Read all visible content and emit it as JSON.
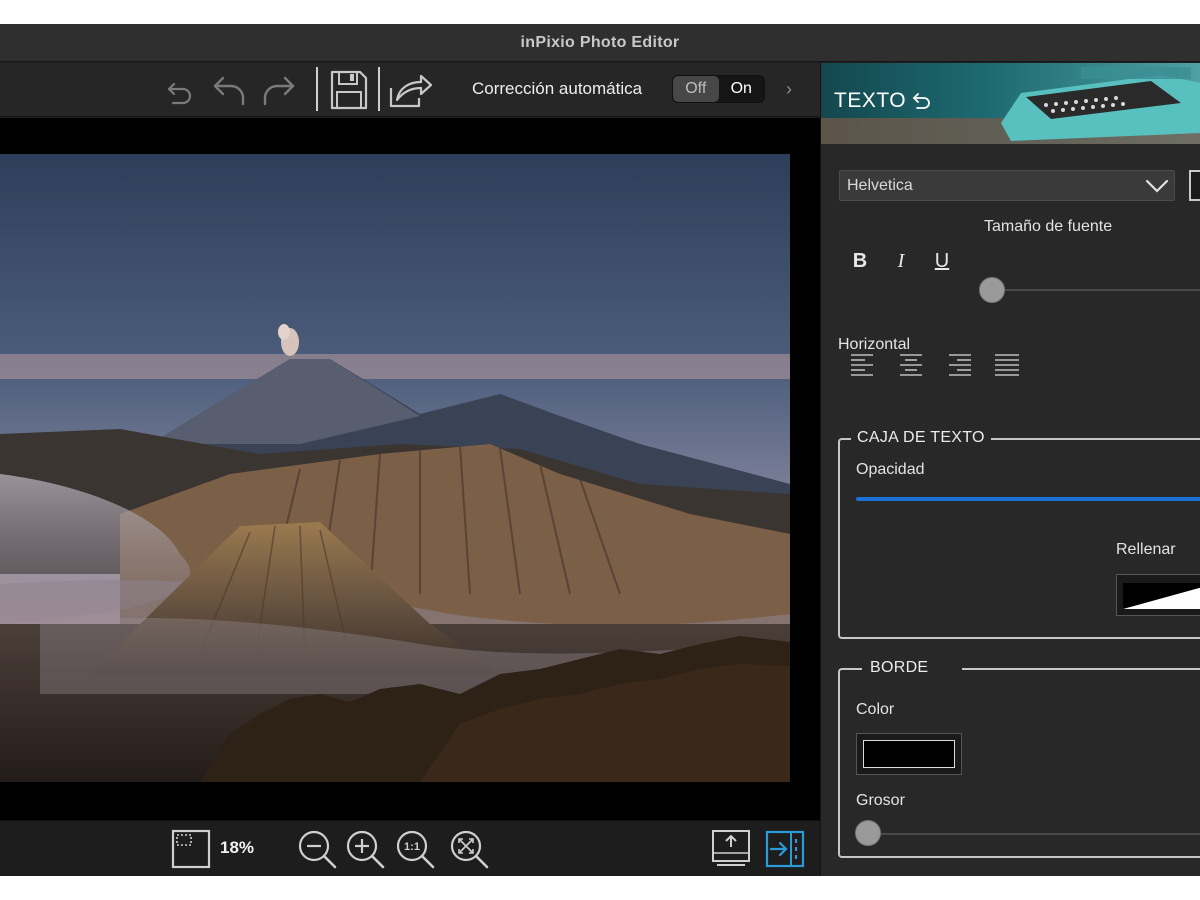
{
  "window": {
    "title": "inPixio Photo Editor"
  },
  "toolbar": {
    "auto_correct_label": "Corrección automática",
    "toggle_off": "Off",
    "toggle_on": "On",
    "toggle_state": "off",
    "more_chevron": "›"
  },
  "canvas": {
    "photo_alt": "Volcanic landscape at dawn"
  },
  "bottombar": {
    "zoom_value": "18%",
    "zoom_in_label": "+",
    "fit_label": "1:1"
  },
  "panel": {
    "banner_title": "TEXTO",
    "font": {
      "selected": "Helvetica"
    },
    "font_size_label": "Tamaño de fuente",
    "font_size_level": 0,
    "style_buttons": {
      "bold": "B",
      "italic": "I",
      "underline": "U"
    },
    "horizontal_label": "Horizontal",
    "text_box": {
      "legend": "CAJA DE TEXTO",
      "opacity_label": "Opacidad",
      "opacity_level": 1.0,
      "fill_label": "Rellenar"
    },
    "border": {
      "legend": "BORDE",
      "color_label": "Color",
      "color_value": "#000000",
      "thickness_label": "Grosor",
      "thickness_level": 0
    }
  },
  "colors": {
    "accent": "#1b6fd6",
    "active_icon": "#2a9bd8",
    "titlebar": "#2f2f2f"
  }
}
